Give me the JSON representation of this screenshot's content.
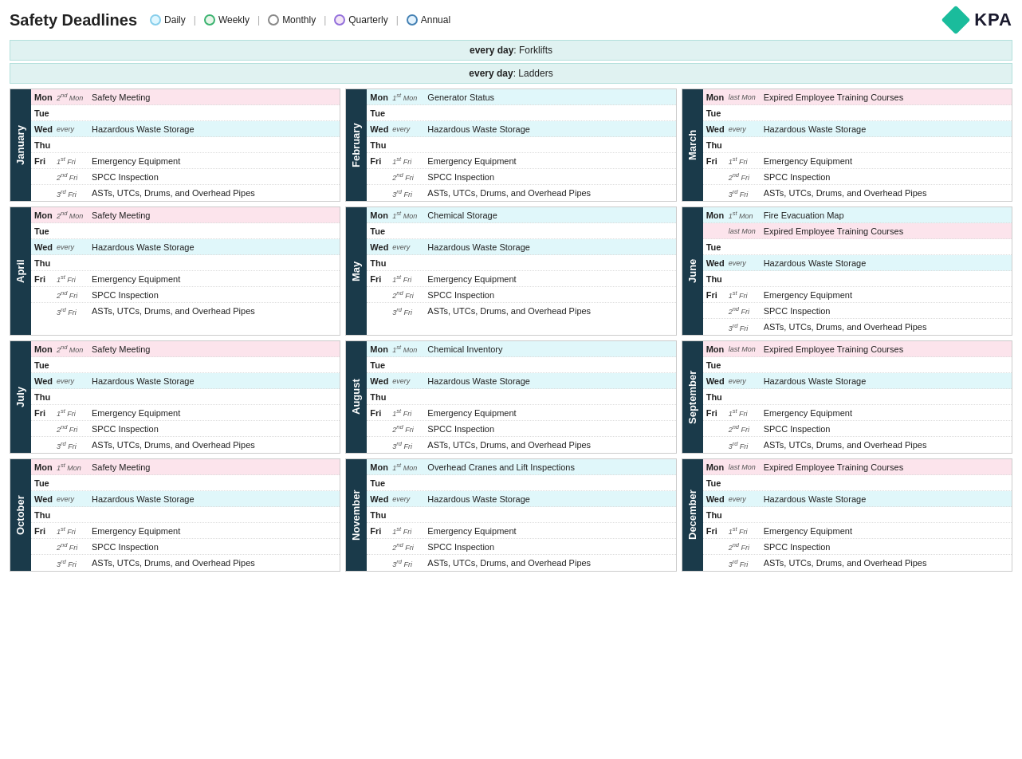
{
  "header": {
    "title": "Safety Deadlines",
    "legend": [
      {
        "label": "Daily",
        "color": "#87ceeb",
        "borderColor": "#87ceeb"
      },
      {
        "label": "Weekly",
        "color": "#3cb371",
        "borderColor": "#3cb371"
      },
      {
        "label": "Monthly",
        "color": "#d3d3d3",
        "borderColor": "#888"
      },
      {
        "label": "Quarterly",
        "color": "#dda0dd",
        "borderColor": "#9370db"
      },
      {
        "label": "Annual",
        "color": "#87ceeb",
        "borderColor": "#4682b4"
      }
    ]
  },
  "banners": [
    {
      "text": "every day",
      "task": "Forklifts"
    },
    {
      "text": "every day",
      "task": "Ladders"
    }
  ],
  "months": [
    {
      "name": "January",
      "rows": [
        {
          "day": "Mon",
          "occ": "2nd Mon",
          "task": "Safety Meeting",
          "color": "pink"
        },
        {
          "day": "Tue",
          "occ": "",
          "task": "",
          "color": "empty"
        },
        {
          "day": "Wed",
          "occ": "every",
          "task": "Hazardous Waste Storage",
          "color": "teal"
        },
        {
          "day": "Thu",
          "occ": "",
          "task": "",
          "color": "empty"
        },
        {
          "day": "Fri",
          "occ": "1st Fri",
          "task": "Emergency Equipment",
          "color": "white"
        },
        {
          "day": "",
          "occ": "2nd Fri",
          "task": "SPCC Inspection",
          "color": "white"
        },
        {
          "day": "",
          "occ": "3rd Fri",
          "task": "ASTs, UTCs, Drums, and Overhead Pipes",
          "color": "white"
        }
      ]
    },
    {
      "name": "February",
      "rows": [
        {
          "day": "Mon",
          "occ": "1st Mon",
          "task": "Generator Status",
          "color": "teal"
        },
        {
          "day": "Tue",
          "occ": "",
          "task": "",
          "color": "empty"
        },
        {
          "day": "Wed",
          "occ": "every",
          "task": "Hazardous Waste Storage",
          "color": "teal"
        },
        {
          "day": "Thu",
          "occ": "",
          "task": "",
          "color": "empty"
        },
        {
          "day": "Fri",
          "occ": "1st Fri",
          "task": "Emergency Equipment",
          "color": "white"
        },
        {
          "day": "",
          "occ": "2nd Fri",
          "task": "SPCC Inspection",
          "color": "white"
        },
        {
          "day": "",
          "occ": "3rd Fri",
          "task": "ASTs, UTCs, Drums, and Overhead Pipes",
          "color": "white"
        }
      ]
    },
    {
      "name": "March",
      "rows": [
        {
          "day": "Mon",
          "occ": "last Mon",
          "task": "Expired Employee Training Courses",
          "color": "pink"
        },
        {
          "day": "Tue",
          "occ": "",
          "task": "",
          "color": "empty"
        },
        {
          "day": "Wed",
          "occ": "every",
          "task": "Hazardous Waste Storage",
          "color": "teal"
        },
        {
          "day": "Thu",
          "occ": "",
          "task": "",
          "color": "empty"
        },
        {
          "day": "Fri",
          "occ": "1st Fri",
          "task": "Emergency Equipment",
          "color": "white"
        },
        {
          "day": "",
          "occ": "2nd Fri",
          "task": "SPCC Inspection",
          "color": "white"
        },
        {
          "day": "",
          "occ": "3rd Fri",
          "task": "ASTs, UTCs, Drums, and Overhead Pipes",
          "color": "white"
        }
      ]
    },
    {
      "name": "April",
      "rows": [
        {
          "day": "Mon",
          "occ": "2nd Mon",
          "task": "Safety Meeting",
          "color": "pink"
        },
        {
          "day": "Tue",
          "occ": "",
          "task": "",
          "color": "empty"
        },
        {
          "day": "Wed",
          "occ": "every",
          "task": "Hazardous Waste Storage",
          "color": "teal"
        },
        {
          "day": "Thu",
          "occ": "",
          "task": "",
          "color": "empty"
        },
        {
          "day": "Fri",
          "occ": "1st Fri",
          "task": "Emergency Equipment",
          "color": "white"
        },
        {
          "day": "",
          "occ": "2nd Fri",
          "task": "SPCC Inspection",
          "color": "white"
        },
        {
          "day": "",
          "occ": "3rd Fri",
          "task": "ASTs, UTCs, Drums, and Overhead Pipes",
          "color": "white"
        }
      ]
    },
    {
      "name": "May",
      "rows": [
        {
          "day": "Mon",
          "occ": "1st Mon",
          "task": "Chemical Storage",
          "color": "teal"
        },
        {
          "day": "Tue",
          "occ": "",
          "task": "",
          "color": "empty"
        },
        {
          "day": "Wed",
          "occ": "every",
          "task": "Hazardous Waste Storage",
          "color": "teal"
        },
        {
          "day": "Thu",
          "occ": "",
          "task": "",
          "color": "empty"
        },
        {
          "day": "Fri",
          "occ": "1st Fri",
          "task": "Emergency Equipment",
          "color": "white"
        },
        {
          "day": "",
          "occ": "2nd Fri",
          "task": "SPCC Inspection",
          "color": "white"
        },
        {
          "day": "",
          "occ": "3rd Fri",
          "task": "ASTs, UTCs, Drums, and Overhead Pipes",
          "color": "white"
        }
      ]
    },
    {
      "name": "June",
      "rows": [
        {
          "day": "Mon",
          "occ": "1st Mon",
          "task": "Fire Evacuation Map",
          "color": "teal"
        },
        {
          "day": "",
          "occ": "last Mon",
          "task": "Expired Employee Training Courses",
          "color": "pink"
        },
        {
          "day": "Tue",
          "occ": "",
          "task": "",
          "color": "empty"
        },
        {
          "day": "Wed",
          "occ": "every",
          "task": "Hazardous Waste Storage",
          "color": "teal"
        },
        {
          "day": "Thu",
          "occ": "",
          "task": "",
          "color": "empty"
        },
        {
          "day": "Fri",
          "occ": "1st Fri",
          "task": "Emergency Equipment",
          "color": "white"
        },
        {
          "day": "",
          "occ": "2nd Fri",
          "task": "SPCC Inspection",
          "color": "white"
        },
        {
          "day": "",
          "occ": "3rd Fri",
          "task": "ASTs, UTCs, Drums, and Overhead Pipes",
          "color": "white"
        }
      ]
    },
    {
      "name": "July",
      "rows": [
        {
          "day": "Mon",
          "occ": "2nd Mon",
          "task": "Safety Meeting",
          "color": "pink"
        },
        {
          "day": "Tue",
          "occ": "",
          "task": "",
          "color": "empty"
        },
        {
          "day": "Wed",
          "occ": "every",
          "task": "Hazardous Waste Storage",
          "color": "teal"
        },
        {
          "day": "Thu",
          "occ": "",
          "task": "",
          "color": "empty"
        },
        {
          "day": "Fri",
          "occ": "1st Fri",
          "task": "Emergency Equipment",
          "color": "white"
        },
        {
          "day": "",
          "occ": "2nd Fri",
          "task": "SPCC Inspection",
          "color": "white"
        },
        {
          "day": "",
          "occ": "3rd Fri",
          "task": "ASTs, UTCs, Drums, and Overhead Pipes",
          "color": "white"
        }
      ]
    },
    {
      "name": "August",
      "rows": [
        {
          "day": "Mon",
          "occ": "1st Mon",
          "task": "Chemical Inventory",
          "color": "teal"
        },
        {
          "day": "Tue",
          "occ": "",
          "task": "",
          "color": "empty"
        },
        {
          "day": "Wed",
          "occ": "every",
          "task": "Hazardous Waste Storage",
          "color": "teal"
        },
        {
          "day": "Thu",
          "occ": "",
          "task": "",
          "color": "empty"
        },
        {
          "day": "Fri",
          "occ": "1st Fri",
          "task": "Emergency Equipment",
          "color": "white"
        },
        {
          "day": "",
          "occ": "2nd Fri",
          "task": "SPCC Inspection",
          "color": "white"
        },
        {
          "day": "",
          "occ": "3rd Fri",
          "task": "ASTs, UTCs, Drums, and Overhead Pipes",
          "color": "white"
        }
      ]
    },
    {
      "name": "September",
      "rows": [
        {
          "day": "Mon",
          "occ": "last Mon",
          "task": "Expired Employee Training Courses",
          "color": "pink"
        },
        {
          "day": "Tue",
          "occ": "",
          "task": "",
          "color": "empty"
        },
        {
          "day": "Wed",
          "occ": "every",
          "task": "Hazardous Waste Storage",
          "color": "teal"
        },
        {
          "day": "Thu",
          "occ": "",
          "task": "",
          "color": "empty"
        },
        {
          "day": "Fri",
          "occ": "1st Fri",
          "task": "Emergency Equipment",
          "color": "white"
        },
        {
          "day": "",
          "occ": "2nd Fri",
          "task": "SPCC Inspection",
          "color": "white"
        },
        {
          "day": "",
          "occ": "3rd Fri",
          "task": "ASTs, UTCs, Drums, and Overhead Pipes",
          "color": "white"
        }
      ]
    },
    {
      "name": "October",
      "rows": [
        {
          "day": "Mon",
          "occ": "1st Mon",
          "task": "Safety Meeting",
          "color": "pink"
        },
        {
          "day": "Tue",
          "occ": "",
          "task": "",
          "color": "empty"
        },
        {
          "day": "Wed",
          "occ": "every",
          "task": "Hazardous Waste Storage",
          "color": "teal"
        },
        {
          "day": "Thu",
          "occ": "",
          "task": "",
          "color": "empty"
        },
        {
          "day": "Fri",
          "occ": "1st Fri",
          "task": "Emergency Equipment",
          "color": "white"
        },
        {
          "day": "",
          "occ": "2nd Fri",
          "task": "SPCC Inspection",
          "color": "white"
        },
        {
          "day": "",
          "occ": "3rd Fri",
          "task": "ASTs, UTCs, Drums, and Overhead Pipes",
          "color": "white"
        }
      ]
    },
    {
      "name": "November",
      "rows": [
        {
          "day": "Mon",
          "occ": "1st Mon",
          "task": "Overhead Cranes and Lift Inspections",
          "color": "teal"
        },
        {
          "day": "Tue",
          "occ": "",
          "task": "",
          "color": "empty"
        },
        {
          "day": "Wed",
          "occ": "every",
          "task": "Hazardous Waste Storage",
          "color": "teal"
        },
        {
          "day": "Thu",
          "occ": "",
          "task": "",
          "color": "empty"
        },
        {
          "day": "Fri",
          "occ": "1st Fri",
          "task": "Emergency Equipment",
          "color": "white"
        },
        {
          "day": "",
          "occ": "2nd Fri",
          "task": "SPCC Inspection",
          "color": "white"
        },
        {
          "day": "",
          "occ": "3rd Fri",
          "task": "ASTs, UTCs, Drums, and Overhead Pipes",
          "color": "white"
        }
      ]
    },
    {
      "name": "December",
      "rows": [
        {
          "day": "Mon",
          "occ": "last Mon",
          "task": "Expired Employee Training Courses",
          "color": "pink"
        },
        {
          "day": "Tue",
          "occ": "",
          "task": "",
          "color": "empty"
        },
        {
          "day": "Wed",
          "occ": "every",
          "task": "Hazardous Waste Storage",
          "color": "teal"
        },
        {
          "day": "Thu",
          "occ": "",
          "task": "",
          "color": "empty"
        },
        {
          "day": "Fri",
          "occ": "1st Fri",
          "task": "Emergency Equipment",
          "color": "white"
        },
        {
          "day": "",
          "occ": "2nd Fri",
          "task": "SPCC Inspection",
          "color": "white"
        },
        {
          "day": "",
          "occ": "3rd Fri",
          "task": "ASTs, UTCs, Drums, and Overhead Pipes",
          "color": "white"
        }
      ]
    }
  ]
}
